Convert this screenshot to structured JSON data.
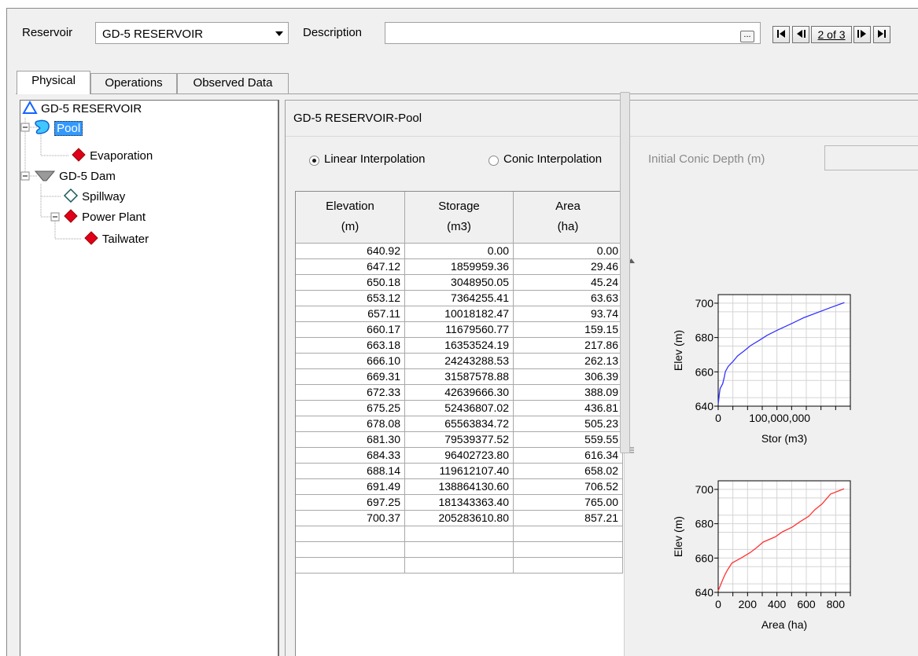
{
  "header": {
    "reservoir_label": "Reservoir",
    "reservoir_value": "GD-5 RESERVOIR",
    "description_label": "Description",
    "description_value": "",
    "ellipsis": "...",
    "record_nav": "2 of 3"
  },
  "tabs": [
    "Physical",
    "Operations",
    "Observed Data"
  ],
  "tree": {
    "root": "GD-5 RESERVOIR",
    "pool": "Pool",
    "evaporation": "Evaporation",
    "dam": "GD-5 Dam",
    "spillway": "Spillway",
    "power_plant": "Power Plant",
    "tailwater": "Tailwater"
  },
  "panel": {
    "title": "GD-5 RESERVOIR-Pool",
    "linear_label": "Linear Interpolation",
    "conic_label": "Conic Interpolation",
    "depth_label": "Initial Conic Depth (m)",
    "depth_value": "",
    "interpolation_selected": "linear"
  },
  "table": {
    "headers": [
      {
        "line1": "Elevation",
        "line2": "(m)"
      },
      {
        "line1": "Storage",
        "line2": "(m3)"
      },
      {
        "line1": "Area",
        "line2": "(ha)"
      }
    ],
    "rows": [
      [
        "640.92",
        "0.00",
        "0.00"
      ],
      [
        "647.12",
        "1859959.36",
        "29.46"
      ],
      [
        "650.18",
        "3048950.05",
        "45.24"
      ],
      [
        "653.12",
        "7364255.41",
        "63.63"
      ],
      [
        "657.11",
        "10018182.47",
        "93.74"
      ],
      [
        "660.17",
        "11679560.77",
        "159.15"
      ],
      [
        "663.18",
        "16353524.19",
        "217.86"
      ],
      [
        "666.10",
        "24243288.53",
        "262.13"
      ],
      [
        "669.31",
        "31587578.88",
        "306.39"
      ],
      [
        "672.33",
        "42639666.30",
        "388.09"
      ],
      [
        "675.25",
        "52436807.02",
        "436.81"
      ],
      [
        "678.08",
        "65563834.72",
        "505.23"
      ],
      [
        "681.30",
        "79539377.52",
        "559.55"
      ],
      [
        "684.33",
        "96402723.80",
        "616.34"
      ],
      [
        "688.14",
        "119612107.40",
        "658.02"
      ],
      [
        "691.49",
        "138864130.60",
        "706.52"
      ],
      [
        "697.25",
        "181343363.40",
        "765.00"
      ],
      [
        "700.37",
        "205283610.80",
        "857.21"
      ]
    ]
  },
  "chart_data": [
    {
      "type": "line",
      "xlabel": "Stor (m3)",
      "ylabel": "Elev (m)",
      "xlim": [
        0,
        215000000
      ],
      "ylim": [
        640,
        705
      ],
      "x_ticks": [
        "0",
        "100,000,000"
      ],
      "y_ticks": [
        "640",
        "660",
        "680",
        "700"
      ],
      "color": "#3333ff",
      "grid": true,
      "x": [
        0,
        1859959.36,
        3048950.05,
        7364255.41,
        10018182.47,
        11679560.77,
        16353524.19,
        24243288.53,
        31587578.88,
        42639666.3,
        52436807.02,
        65563834.72,
        79539377.52,
        96402723.8,
        119612107.4,
        138864130.6,
        181343363.4,
        205283610.8
      ],
      "y": [
        640.92,
        647.12,
        650.18,
        653.12,
        657.11,
        660.17,
        663.18,
        666.1,
        669.31,
        672.33,
        675.25,
        678.08,
        681.3,
        684.33,
        688.14,
        691.49,
        697.25,
        700.37
      ]
    },
    {
      "type": "line",
      "xlabel": "Area (ha)",
      "ylabel": "Elev (m)",
      "xlim": [
        0,
        900
      ],
      "ylim": [
        640,
        705
      ],
      "x_ticks": [
        "0",
        "200",
        "400",
        "600",
        "800"
      ],
      "y_ticks": [
        "640",
        "660",
        "680",
        "700"
      ],
      "color": "#ff3333",
      "grid": true,
      "x": [
        0,
        29.46,
        45.24,
        63.63,
        93.74,
        159.15,
        217.86,
        262.13,
        306.39,
        388.09,
        436.81,
        505.23,
        559.55,
        616.34,
        658.02,
        706.52,
        765.0,
        857.21
      ],
      "y": [
        640.92,
        647.12,
        650.18,
        653.12,
        657.11,
        660.17,
        663.18,
        666.1,
        669.31,
        672.33,
        675.25,
        678.08,
        681.3,
        684.33,
        688.14,
        691.49,
        697.25,
        700.37
      ]
    }
  ]
}
